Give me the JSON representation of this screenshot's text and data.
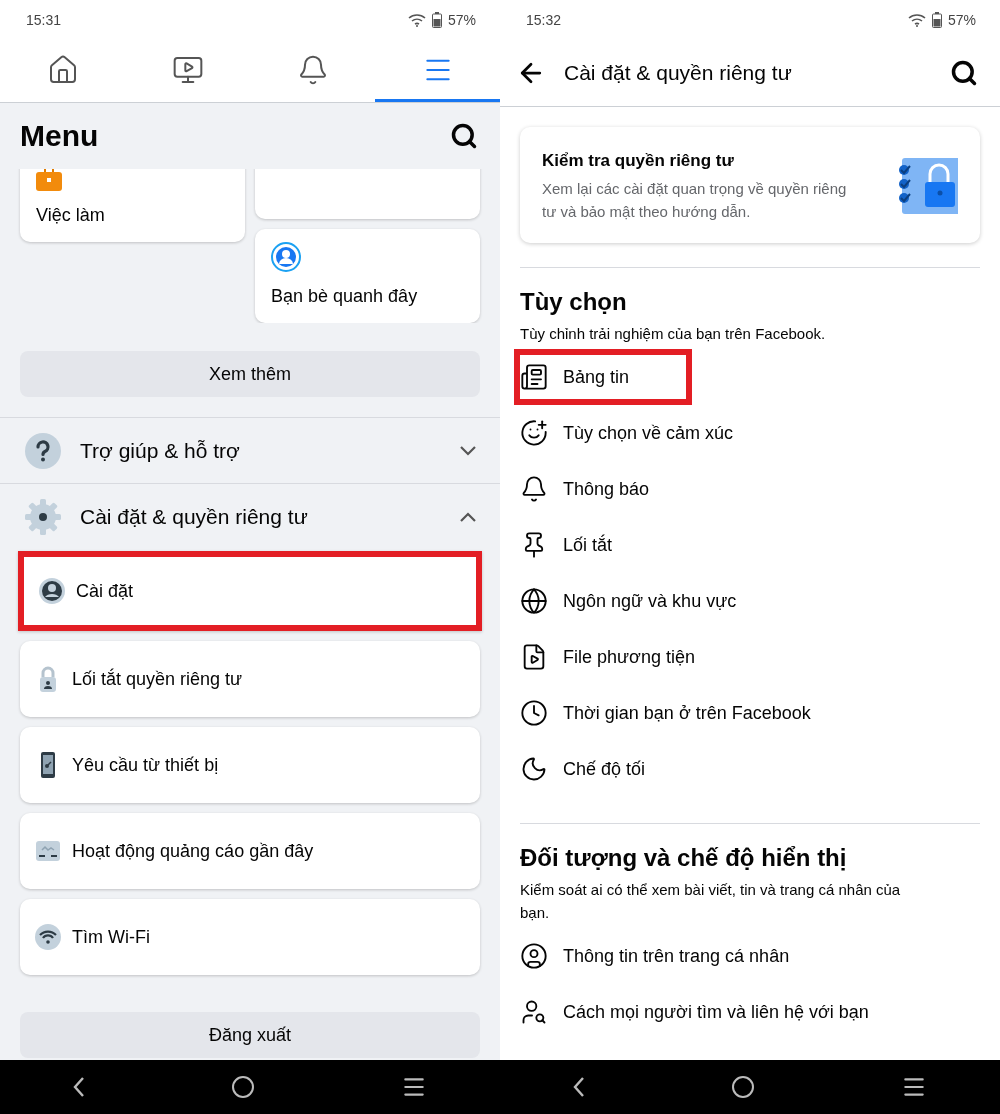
{
  "left_screen": {
    "status_bar": {
      "time": "15:31",
      "battery": "57%"
    },
    "tabs": [
      {
        "selected": false
      },
      {
        "selected": false
      },
      {
        "selected": false
      },
      {
        "selected": true
      }
    ],
    "title": "Menu",
    "shortcuts": [
      {
        "label": "Việc làm"
      },
      {
        "label": "Bạn bè quanh đây"
      }
    ],
    "see_more": "Xem thêm",
    "sections": [
      {
        "label": "Trợ giúp & hỗ trợ",
        "expanded": false
      },
      {
        "label": "Cài đặt & quyền riêng tư",
        "expanded": true
      }
    ],
    "settings_items": [
      {
        "label": "Cài đặt",
        "highlighted": true
      },
      {
        "label": "Lối tắt quyền riêng tư",
        "highlighted": false
      },
      {
        "label": "Yêu cầu từ thiết bị",
        "highlighted": false
      },
      {
        "label": "Hoạt động quảng cáo gần đây",
        "highlighted": false
      },
      {
        "label": "Tìm Wi-Fi",
        "highlighted": false
      }
    ],
    "logout": "Đăng xuất"
  },
  "right_screen": {
    "status_bar": {
      "time": "15:32",
      "battery": "57%"
    },
    "title": "Cài đặt & quyền riêng tư",
    "privacy_card": {
      "title": "Kiểm tra quyền riêng tư",
      "text": "Xem lại các cài đặt quan trọng về quyền riêng tư và bảo mật theo hướng dẫn."
    },
    "sections": [
      {
        "title": "Tùy chọn",
        "subtitle": "Tùy chỉnh trải nghiệm của bạn trên Facebook.",
        "items": [
          {
            "label": "Bảng tin",
            "highlighted": true
          },
          {
            "label": "Tùy chọn về cảm xúc",
            "highlighted": false
          },
          {
            "label": "Thông báo",
            "highlighted": false
          },
          {
            "label": "Lối tắt",
            "highlighted": false
          },
          {
            "label": "Ngôn ngữ và khu vực",
            "highlighted": false
          },
          {
            "label": "File phương tiện",
            "highlighted": false
          },
          {
            "label": "Thời gian bạn ở trên Facebook",
            "highlighted": false
          },
          {
            "label": "Chế độ tối",
            "highlighted": false
          }
        ]
      },
      {
        "title": "Đối tượng và chế độ hiển thị",
        "subtitle": "Kiểm soát ai có thể xem bài viết, tin và trang cá nhân của bạn.",
        "items": [
          {
            "label": "Thông tin trên trang cá nhân",
            "highlighted": false
          },
          {
            "label": "Cách mọi người tìm và liên hệ với bạn",
            "highlighted": false
          }
        ]
      }
    ]
  }
}
